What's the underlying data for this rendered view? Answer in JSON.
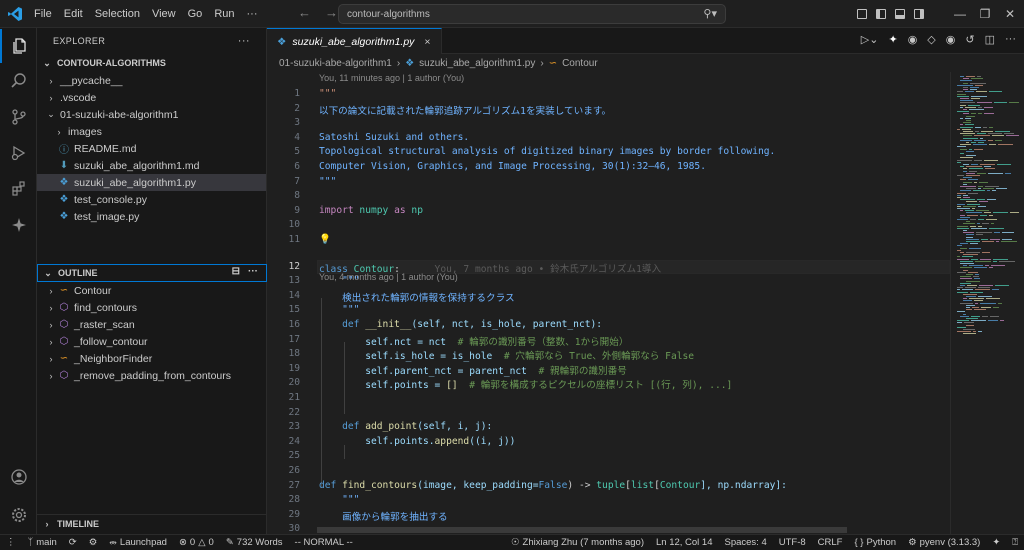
{
  "titlebar": {
    "menu": [
      "File",
      "Edit",
      "Selection",
      "View",
      "Go",
      "Run",
      "···"
    ],
    "search": "contour-algorithms"
  },
  "sidebar": {
    "explorer_title": "EXPLORER",
    "more": "···",
    "root": "CONTOUR-ALGORITHMS",
    "tree": [
      {
        "label": "__pycache__",
        "kind": "folder",
        "depth": 1
      },
      {
        "label": ".vscode",
        "kind": "folder",
        "depth": 1
      },
      {
        "label": "01-suzuki-abe-algorithm1",
        "kind": "folder-open",
        "depth": 1
      },
      {
        "label": "images",
        "kind": "folder",
        "depth": 2
      },
      {
        "label": "README.md",
        "kind": "info",
        "depth": 2
      },
      {
        "label": "suzuki_abe_algorithm1.md",
        "kind": "md",
        "depth": 2
      },
      {
        "label": "suzuki_abe_algorithm1.py",
        "kind": "py",
        "depth": 2,
        "selected": true
      },
      {
        "label": "test_console.py",
        "kind": "py",
        "depth": 2
      },
      {
        "label": "test_image.py",
        "kind": "py",
        "depth": 2
      }
    ],
    "outline_title": "OUTLINE",
    "outline": [
      {
        "label": "Contour",
        "kind": "class"
      },
      {
        "label": "find_contours",
        "kind": "func"
      },
      {
        "label": "_raster_scan",
        "kind": "func"
      },
      {
        "label": "_follow_contour",
        "kind": "func"
      },
      {
        "label": "_NeighborFinder",
        "kind": "class"
      },
      {
        "label": "_remove_padding_from_contours",
        "kind": "func"
      }
    ],
    "timeline_title": "TIMELINE"
  },
  "editor": {
    "tab": "suzuki_abe_algorithm1.py",
    "close": "×",
    "breadcrumb": [
      "01-suzuki-abe-algorithm1",
      "suzuki_abe_algorithm1.py",
      "Contour"
    ],
    "lens_top": "You, 11 minutes ago | 1 author (You)",
    "lens_class": "You, 4 months ago | 1 author (You)",
    "current_line": 12,
    "lines": [
      {
        "n": 1,
        "t": [
          [
            "\"\"\"",
            "str"
          ]
        ]
      },
      {
        "n": 2,
        "t": [
          [
            "以下の論文に記載された輪郭追跡アルゴリズム1を実装しています。",
            "doc"
          ]
        ]
      },
      {
        "n": 3,
        "t": []
      },
      {
        "n": 4,
        "t": [
          [
            "Satoshi Suzuki and others.",
            "doc"
          ]
        ]
      },
      {
        "n": 5,
        "t": [
          [
            "Topological structural analysis of digitized binary images by border following.",
            "doc"
          ]
        ]
      },
      {
        "n": 6,
        "t": [
          [
            "Computer Vision, Graphics, and Image Processing, 30(1):32–46, 1985.",
            "doc"
          ]
        ]
      },
      {
        "n": 7,
        "t": [
          [
            "\"\"\"",
            "doc"
          ]
        ]
      },
      {
        "n": 8,
        "t": []
      },
      {
        "n": 9,
        "t": [
          [
            "import",
            "kw2"
          ],
          [
            " numpy ",
            "cls"
          ],
          [
            "as",
            "kw2"
          ],
          [
            " np",
            "cls"
          ]
        ]
      },
      {
        "n": 10,
        "t": []
      },
      {
        "n": 11,
        "t": [
          [
            "💡",
            "fn"
          ]
        ]
      },
      {
        "n": 12,
        "t": [
          [
            "class",
            "kw"
          ],
          [
            " ",
            ""
          ],
          [
            "Contour",
            "cls"
          ],
          [
            ":",
            ""
          ],
          [
            "      You, 7 months ago • 鈴木氏アルゴリズム1導入",
            "blame"
          ]
        ]
      },
      {
        "n": 13,
        "t": [
          [
            "    \"\"\"",
            "doc"
          ]
        ]
      },
      {
        "n": 14,
        "t": [
          [
            "    検出された輪郭の情報を保持するクラス",
            "doc"
          ]
        ]
      },
      {
        "n": 15,
        "t": [
          [
            "    \"\"\"",
            "doc"
          ]
        ]
      },
      {
        "n": 16,
        "t": [
          [
            "    ",
            ""
          ],
          [
            "def",
            "kw"
          ],
          [
            " ",
            ""
          ],
          [
            "__init__",
            "fn"
          ],
          [
            "(self, nct, is_hole, parent_nct):",
            "var"
          ]
        ]
      },
      {
        "n": 17,
        "t": [
          [
            "        self.nct = ",
            "var"
          ],
          [
            "nct",
            "var"
          ],
          [
            "  # 輪郭の識別番号（整数、1から開始）",
            "cm"
          ]
        ]
      },
      {
        "n": 18,
        "t": [
          [
            "        self.is_hole = ",
            "var"
          ],
          [
            "is_hole",
            "var"
          ],
          [
            "  # 穴輪郭なら True、外側輪郭なら False",
            "cm"
          ]
        ]
      },
      {
        "n": 19,
        "t": [
          [
            "        self.parent_nct = ",
            "var"
          ],
          [
            "parent_nct",
            "var"
          ],
          [
            "  # 親輪郭の識別番号",
            "cm"
          ]
        ]
      },
      {
        "n": 20,
        "t": [
          [
            "        self.points = ",
            "var"
          ],
          [
            "[]",
            "fn"
          ],
          [
            "  # 輪郭を構成するピクセルの座標リスト [(行, 列), ...]",
            "cm"
          ]
        ]
      },
      {
        "n": 21,
        "t": []
      },
      {
        "n": 22,
        "t": []
      },
      {
        "n": 23,
        "t": [
          [
            "    ",
            ""
          ],
          [
            "def",
            "kw"
          ],
          [
            " ",
            ""
          ],
          [
            "add_point",
            "fn"
          ],
          [
            "(self, i, j):",
            "var"
          ]
        ]
      },
      {
        "n": 24,
        "t": [
          [
            "        self.points.",
            "var"
          ],
          [
            "append",
            "fn"
          ],
          [
            "((i, j))",
            "var"
          ]
        ]
      },
      {
        "n": 25,
        "t": []
      },
      {
        "n": 26,
        "t": []
      },
      {
        "n": 27,
        "t": [
          [
            "def",
            "kw"
          ],
          [
            " ",
            ""
          ],
          [
            "find_contours",
            "fn"
          ],
          [
            "(image, keep_padding=",
            "var"
          ],
          [
            "False",
            "kw"
          ],
          [
            ") -> ",
            ""
          ],
          [
            "tuple",
            "ty"
          ],
          [
            "[",
            ""
          ],
          [
            "list",
            "ty"
          ],
          [
            "[",
            ""
          ],
          [
            "Contour",
            "ty"
          ],
          [
            "], np.ndarray]:",
            "var"
          ]
        ]
      },
      {
        "n": 28,
        "t": [
          [
            "    \"\"\"",
            "doc"
          ]
        ]
      },
      {
        "n": 29,
        "t": [
          [
            "    画像から輪郭を抽出する",
            "doc"
          ]
        ]
      },
      {
        "n": 30,
        "t": []
      }
    ]
  },
  "statusbar": {
    "branch": "main",
    "launchpad": "Launchpad",
    "errors": "0",
    "warnings": "0",
    "words": "732 Words",
    "mode": "-- NORMAL --",
    "blame": "Zhixiang Zhu (7 months ago)",
    "position": "Ln 12, Col 14",
    "spaces": "Spaces: 4",
    "encoding": "UTF-8",
    "eol": "CRLF",
    "language": "Python",
    "interpreter": "pyenv (3.13.3)"
  },
  "colors": {
    "accent": "#0078d4",
    "background": "#1f1f1f",
    "sidebar": "#181818"
  }
}
